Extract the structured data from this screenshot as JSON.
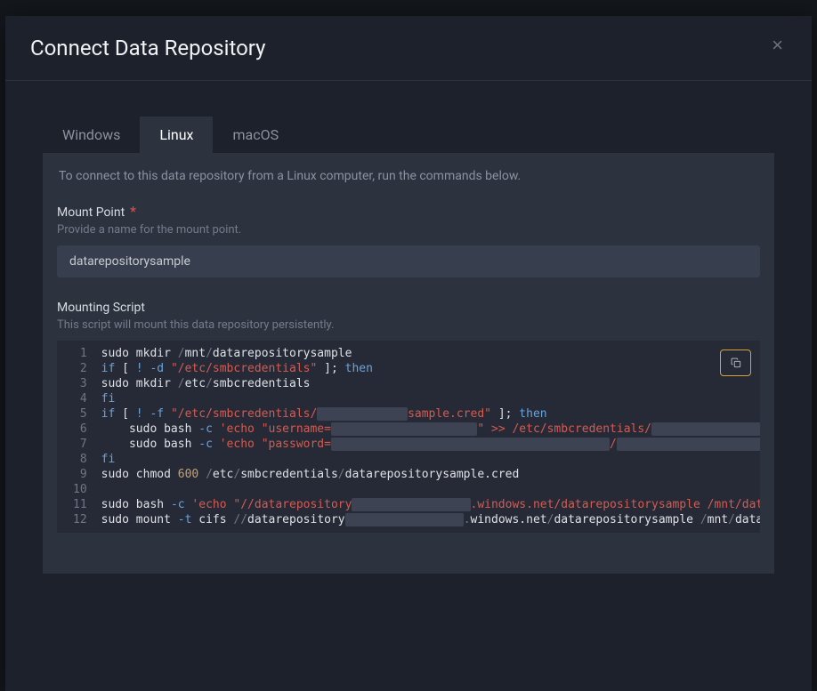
{
  "modal": {
    "title": "Connect Data Repository",
    "close_aria": "Close"
  },
  "tabs": [
    {
      "id": "windows",
      "label": "Windows",
      "active": false
    },
    {
      "id": "linux",
      "label": "Linux",
      "active": true
    },
    {
      "id": "macos",
      "label": "macOS",
      "active": false
    }
  ],
  "linux": {
    "intro": "To connect to this data repository from a Linux computer, run the commands below.",
    "mount_point": {
      "label": "Mount Point",
      "required": "*",
      "help": "Provide a name for the mount point.",
      "value": "datarepositorysample"
    },
    "script": {
      "label": "Mounting Script",
      "help": "This script will mount this data repository persistently.",
      "copy_aria": "Copy script"
    }
  },
  "code": {
    "lines": [
      [
        {
          "t": "sudo",
          "c": "cmd"
        },
        {
          "t": " "
        },
        {
          "t": "mkdir",
          "c": "cmd"
        },
        {
          "t": " "
        },
        {
          "t": "/",
          "c": "slash"
        },
        {
          "t": "mnt",
          "c": "path"
        },
        {
          "t": "/",
          "c": "slash"
        },
        {
          "t": "datarepositorysample",
          "c": "path"
        }
      ],
      [
        {
          "t": "if",
          "c": "kw"
        },
        {
          "t": " "
        },
        {
          "t": "[",
          "c": "cmd"
        },
        {
          "t": " "
        },
        {
          "t": "!",
          "c": "op"
        },
        {
          "t": " "
        },
        {
          "t": "-d",
          "c": "op"
        },
        {
          "t": " "
        },
        {
          "t": "\"/etc/smbcredentials\"",
          "c": "str"
        },
        {
          "t": " "
        },
        {
          "t": "];",
          "c": "cmd"
        },
        {
          "t": " "
        },
        {
          "t": "then",
          "c": "kw"
        }
      ],
      [
        {
          "t": "sudo",
          "c": "cmd"
        },
        {
          "t": " "
        },
        {
          "t": "mkdir",
          "c": "cmd"
        },
        {
          "t": " "
        },
        {
          "t": "/",
          "c": "slash"
        },
        {
          "t": "etc",
          "c": "path"
        },
        {
          "t": "/",
          "c": "slash"
        },
        {
          "t": "smbcredentials",
          "c": "path"
        }
      ],
      [
        {
          "t": "fi",
          "c": "kw"
        }
      ],
      [
        {
          "t": "if",
          "c": "kw"
        },
        {
          "t": " "
        },
        {
          "t": "[",
          "c": "cmd"
        },
        {
          "t": " "
        },
        {
          "t": "!",
          "c": "op"
        },
        {
          "t": " "
        },
        {
          "t": "-f",
          "c": "op"
        },
        {
          "t": " "
        },
        {
          "t": "\"/etc/smbcredentials/",
          "c": "str"
        },
        {
          "t": "xxxxxxxxxxxxx",
          "c": "obscured"
        },
        {
          "t": "sample.cred\"",
          "c": "str"
        },
        {
          "t": " "
        },
        {
          "t": "];",
          "c": "cmd"
        },
        {
          "t": " "
        },
        {
          "t": "then",
          "c": "kw"
        }
      ],
      [
        {
          "t": "    sudo",
          "c": "cmd"
        },
        {
          "t": " "
        },
        {
          "t": "bash",
          "c": "cmd"
        },
        {
          "t": " "
        },
        {
          "t": "-c",
          "c": "op"
        },
        {
          "t": " "
        },
        {
          "t": "'echo \"username=",
          "c": "str"
        },
        {
          "t": "xxxxxxxxxxxxxxxxxxxxx",
          "c": "obscured"
        },
        {
          "t": "\" >> /etc/smbcredentials/",
          "c": "str"
        },
        {
          "t": "xxxxxxxxxxxxxxxxxxxxxxxx",
          "c": "obscured"
        }
      ],
      [
        {
          "t": "    sudo",
          "c": "cmd"
        },
        {
          "t": " "
        },
        {
          "t": "bash",
          "c": "cmd"
        },
        {
          "t": " "
        },
        {
          "t": "-c",
          "c": "op"
        },
        {
          "t": " "
        },
        {
          "t": "'echo \"password=",
          "c": "str"
        },
        {
          "t": "xxxxxxxxxxxxxxxxxxxxxxxxxxxxxxxxxxxxxxxx",
          "c": "obscured"
        },
        {
          "t": "/",
          "c": "str"
        },
        {
          "t": "xxxxxxxxxxxxxxxxxxxxxxxxxxxxxxxxxxxxxxxxxxxxxx",
          "c": "obscured"
        }
      ],
      [
        {
          "t": "fi",
          "c": "kw"
        }
      ],
      [
        {
          "t": "sudo",
          "c": "cmd"
        },
        {
          "t": " "
        },
        {
          "t": "chmod",
          "c": "cmd"
        },
        {
          "t": " "
        },
        {
          "t": "600",
          "c": "num"
        },
        {
          "t": " "
        },
        {
          "t": "/",
          "c": "slash"
        },
        {
          "t": "etc",
          "c": "path"
        },
        {
          "t": "/",
          "c": "slash"
        },
        {
          "t": "smbcredentials",
          "c": "path"
        },
        {
          "t": "/",
          "c": "slash"
        },
        {
          "t": "datarepositorysample.cred",
          "c": "path"
        }
      ],
      [],
      [
        {
          "t": "sudo",
          "c": "cmd"
        },
        {
          "t": " "
        },
        {
          "t": "bash",
          "c": "cmd"
        },
        {
          "t": " "
        },
        {
          "t": "-c",
          "c": "op"
        },
        {
          "t": " "
        },
        {
          "t": "'echo \"//datarepository",
          "c": "str"
        },
        {
          "t": "xxxxxxxxxxxxxxxxx",
          "c": "obscured"
        },
        {
          "t": ".windows.net/datarepositorysample /mnt/datarepositorysample",
          "c": "str"
        }
      ],
      [
        {
          "t": "sudo",
          "c": "cmd"
        },
        {
          "t": " "
        },
        {
          "t": "mount",
          "c": "cmd"
        },
        {
          "t": " "
        },
        {
          "t": "-t",
          "c": "op"
        },
        {
          "t": " "
        },
        {
          "t": "cifs",
          "c": "cmd"
        },
        {
          "t": " "
        },
        {
          "t": "//",
          "c": "slash"
        },
        {
          "t": "datarepository",
          "c": "path"
        },
        {
          "t": "xxxxxxxxxxxxxxxxx",
          "c": "obscured"
        },
        {
          "t": ".",
          "c": "slash"
        },
        {
          "t": "windows.net",
          "c": "path"
        },
        {
          "t": "/",
          "c": "slash"
        },
        {
          "t": "datarepositorysample",
          "c": "path"
        },
        {
          "t": " "
        },
        {
          "t": "/",
          "c": "slash"
        },
        {
          "t": "mnt",
          "c": "path"
        },
        {
          "t": "/",
          "c": "slash"
        },
        {
          "t": "datarepositorysample",
          "c": "path"
        }
      ]
    ]
  }
}
